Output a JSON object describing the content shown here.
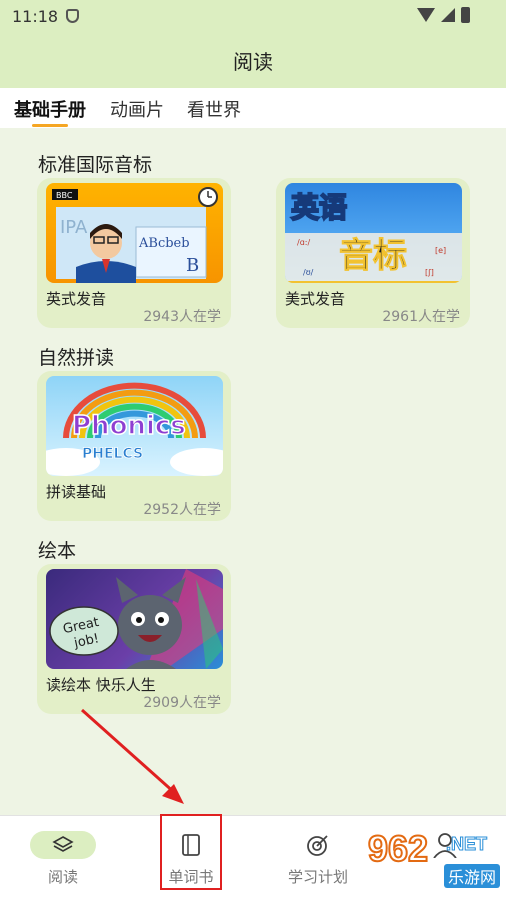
{
  "status": {
    "time": "11:18"
  },
  "header": {
    "title": "阅读"
  },
  "tabs": [
    {
      "label": "基础手册",
      "active": true
    },
    {
      "label": "动画片",
      "active": false
    },
    {
      "label": "看世界",
      "active": false
    }
  ],
  "sections": [
    {
      "title": "标准国际音标",
      "cards": [
        {
          "name": "英式发音",
          "count": "2943人在学",
          "thumb_text": [
            "BBC",
            "IPA",
            "ABcbeb"
          ]
        },
        {
          "name": "美式发音",
          "count": "2961人在学",
          "thumb_text": [
            "英语",
            "音标"
          ]
        }
      ]
    },
    {
      "title": "自然拼读",
      "cards": [
        {
          "name": "拼读基础",
          "count": "2952人在学",
          "thumb_text": [
            "Phonics",
            "PHELCS"
          ]
        }
      ]
    },
    {
      "title": "绘本",
      "cards": [
        {
          "name": "读绘本 快乐人生",
          "count": "2909人在学",
          "thumb_text": [
            "Great",
            "job!"
          ]
        }
      ]
    }
  ],
  "bottom_nav": [
    {
      "label": "阅读",
      "icon": "layers-icon",
      "active": true
    },
    {
      "label": "单词书",
      "icon": "book-icon",
      "active": false
    },
    {
      "label": "学习计划",
      "icon": "target-icon",
      "active": false
    },
    {
      "label": "",
      "icon": "profile-icon",
      "active": false
    }
  ],
  "watermark": {
    "num": "962",
    "net": ".NET",
    "cn": "乐游网"
  },
  "colors": {
    "header_bg": "#dceec1",
    "tab_underline": "#f5a623",
    "card_bg": "#e3efc8",
    "highlight": "#e02020"
  }
}
